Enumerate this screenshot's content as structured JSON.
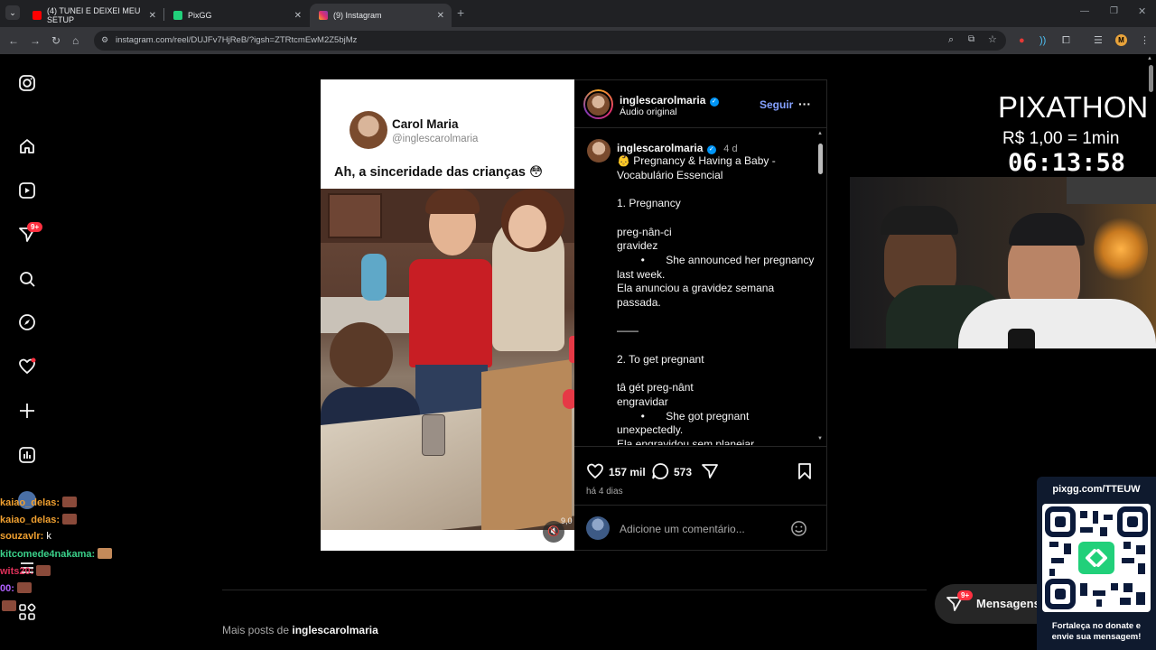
{
  "browser": {
    "tabs": [
      {
        "title": "(4) TUNEI E DEIXEI MEU SETUP",
        "favicon_color": "#ff0000"
      },
      {
        "title": "PixGG",
        "favicon_color": "#21d07a"
      },
      {
        "title": "(9) Instagram",
        "favicon_color": "#e1306c"
      }
    ],
    "new_tab": "+",
    "url": "instagram.com/reel/DUJFv7HjReB/?igsh=ZTRtcmEwM2Z5bjMz",
    "profile_initial": "M"
  },
  "sidebar": {
    "notifications_badge": "9+",
    "messages_badge": "9+"
  },
  "reel": {
    "header_name": "Carol Maria",
    "header_handle": "@inglescarolmaria",
    "header_text": "Ah, a sinceridade das crianças 😳",
    "duration": "9,0"
  },
  "post": {
    "username": "inglescarolmaria",
    "audio": "Áudio original",
    "follow": "Seguir",
    "more": "···",
    "caption_user": "inglescarolmaria",
    "caption_age": "4 d",
    "caption_lines": [
      "👶 Pregnancy & Having a Baby -",
      "Vocabulário Essencial",
      "",
      "1. Pregnancy",
      "",
      "preg-nân-ci",
      "gravidez",
      "        •       She announced her pregnancy",
      "last week.",
      "Ela anunciou a gravidez semana",
      "passada.",
      "",
      "——",
      "",
      "2. To get pregnant",
      "",
      "tâ gét preg-nânt",
      "engravidar",
      "        •       She got pregnant",
      "unexpectedly.",
      "Ela engravidou sem planejar."
    ],
    "likes": "157 mil",
    "comments": "573",
    "date": "há 4 dias",
    "comment_placeholder": "Adicione um comentário..."
  },
  "below": {
    "more_posts_prefix": "Mais posts de ",
    "more_posts_user": "inglescarolmaria",
    "messages_label": "Mensagens"
  },
  "stream": {
    "title": "PIXATHON",
    "rate": "R$ 1,00 = 1min",
    "timer": "06:13:58",
    "pix_url": "pixgg.com/TTEUW",
    "pix_footer": "Fortaleça no donate e envie sua mensagem!",
    "chat": [
      {
        "user": "kaiao_delas:",
        "msg": "",
        "color": "#f0a030",
        "emote": true
      },
      {
        "user": "kaiao_delas:",
        "msg": "",
        "color": "#f0a030",
        "emote": true
      },
      {
        "user": "souzavlr:",
        "msg": "k",
        "color": "#f0a030",
        "emote": false
      },
      {
        "user": "kitcomede4nakama:",
        "msg": "",
        "color": "#3ad18a",
        "emote": true
      },
      {
        "user": "wits20:",
        "msg": "",
        "color": "#e0305a",
        "emote": true
      },
      {
        "user": "00:",
        "msg": "",
        "color": "#b060ff",
        "emote": true
      }
    ]
  }
}
